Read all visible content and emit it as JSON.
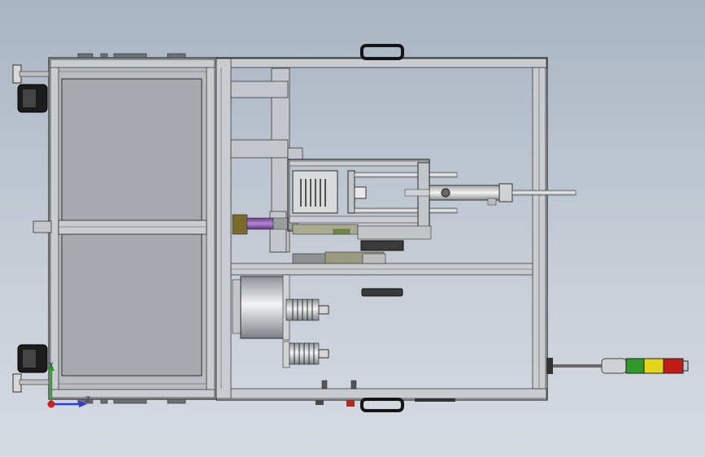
{
  "scene": {
    "view": "top",
    "background_top": "#a9b5c3",
    "background_bottom": "#d6dbe2",
    "frame_color": "#b8bcc0",
    "panel_color": "#a6a9ad",
    "stack_light_colors": [
      "#2f9a2a",
      "#e3d51a",
      "#c21a14"
    ]
  },
  "triad": {
    "y_label": "Y",
    "z_label": "Z",
    "y_color": "#27a127",
    "z_color": "#2b3fcf",
    "origin_color": "#d11f1f"
  }
}
